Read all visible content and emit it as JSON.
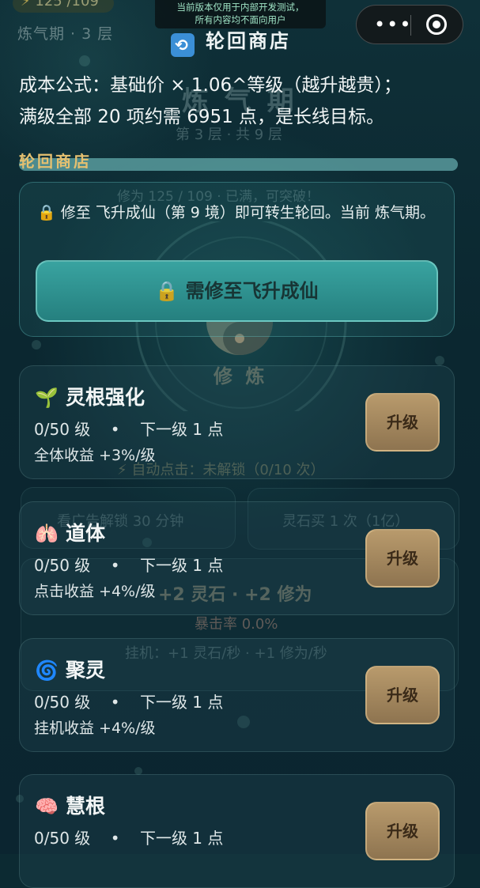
{
  "status": {
    "stat_pill": "125 /109",
    "realm_label": "炼气期 · 3 层",
    "dev_notice_line1": "当前版本仅用于内部开发测试，",
    "dev_notice_line2": "所有内容均不面向用户"
  },
  "capsule": {
    "more": "•••"
  },
  "header": {
    "title": "轮回商店"
  },
  "info": {
    "formula_line1": "成本公式：基础价 × 1.06^等级（越升越贵）；",
    "formula_line2": "满级全部 20 项约需 6951 点，是长线目标。"
  },
  "shop": {
    "section_title": "轮回商店",
    "progress_fraction": 1.0,
    "lock_notice": "🔒 修至 飞升成仙（第 9 境）即可转生轮回。当前 炼气期。",
    "lock_button": "🔒 需修至飞升成仙",
    "items": [
      {
        "icon": "🌱",
        "name": "灵根强化",
        "level": "0/50 级",
        "dot": "•",
        "next": "下一级 1 点",
        "desc": "全体收益 +3%/级",
        "button": "升级"
      },
      {
        "icon": "🫁",
        "name": "道体",
        "level": "0/50 级",
        "dot": "•",
        "next": "下一级 1 点",
        "desc": "点击收益 +4%/级",
        "button": "升级"
      },
      {
        "icon": "🌀",
        "name": "聚灵",
        "level": "0/50 级",
        "dot": "•",
        "next": "下一级 1 点",
        "desc": "挂机收益 +4%/级",
        "button": "升级"
      },
      {
        "icon": "🧠",
        "name": "慧根",
        "level": "0/50 级",
        "dot": "•",
        "next": "下一级 1 点",
        "desc": "",
        "button": "升级"
      }
    ]
  },
  "background": {
    "realm_big": "炼 气 期",
    "realm_sub": "第 3 层 · 共 9 层",
    "xiuwei": "修为 125 / 109 · 已满，可突破！",
    "cultivate": "修 炼",
    "auto_click": "⚡ 自动点击：未解锁（0/10 次）",
    "ad_unlock": "看广告解锁 30 分钟",
    "buy_once": "灵石买 1 次（1亿）",
    "gain": "+2 灵石 · +2 修为",
    "crit": "暴击率 0.0%",
    "idle": "挂机：+1 灵石/秒 · +1 修为/秒"
  }
}
